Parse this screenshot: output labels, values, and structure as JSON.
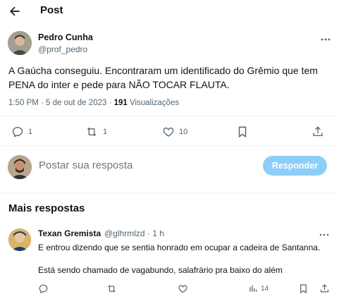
{
  "header": {
    "title": "Post"
  },
  "post": {
    "author_name": "Pedro Cunha",
    "author_handle": "@prof_pedro",
    "text": "A Gaúcha conseguiu. Encontraram um identificado do Grêmio que tem PENA do inter e pede para NÃO TOCAR FLAUTA.",
    "time_date": "1:50 PM · 5 de out de 2023 · ",
    "views_count": "191",
    "views_label": " Visualizações",
    "replies": "1",
    "reposts": "1",
    "likes": "10"
  },
  "composer": {
    "placeholder": "Postar sua resposta",
    "button_label": "Responder"
  },
  "more_replies": {
    "title": "Mais respostas",
    "items": [
      {
        "name": "Texan Gremista",
        "handle_time": "@glhrmlzd · 1 h",
        "line1": "E entrou dizendo que se sentia honrado em ocupar a cadeira de Santanna.",
        "line2": "Está sendo chamado de vagabundo, salafrário pra baixo do além",
        "views": "14"
      }
    ]
  },
  "colors": {
    "text": "#0f1419",
    "secondary": "#536471",
    "button": "#8ecdf8",
    "divider": "#eff3f4"
  }
}
